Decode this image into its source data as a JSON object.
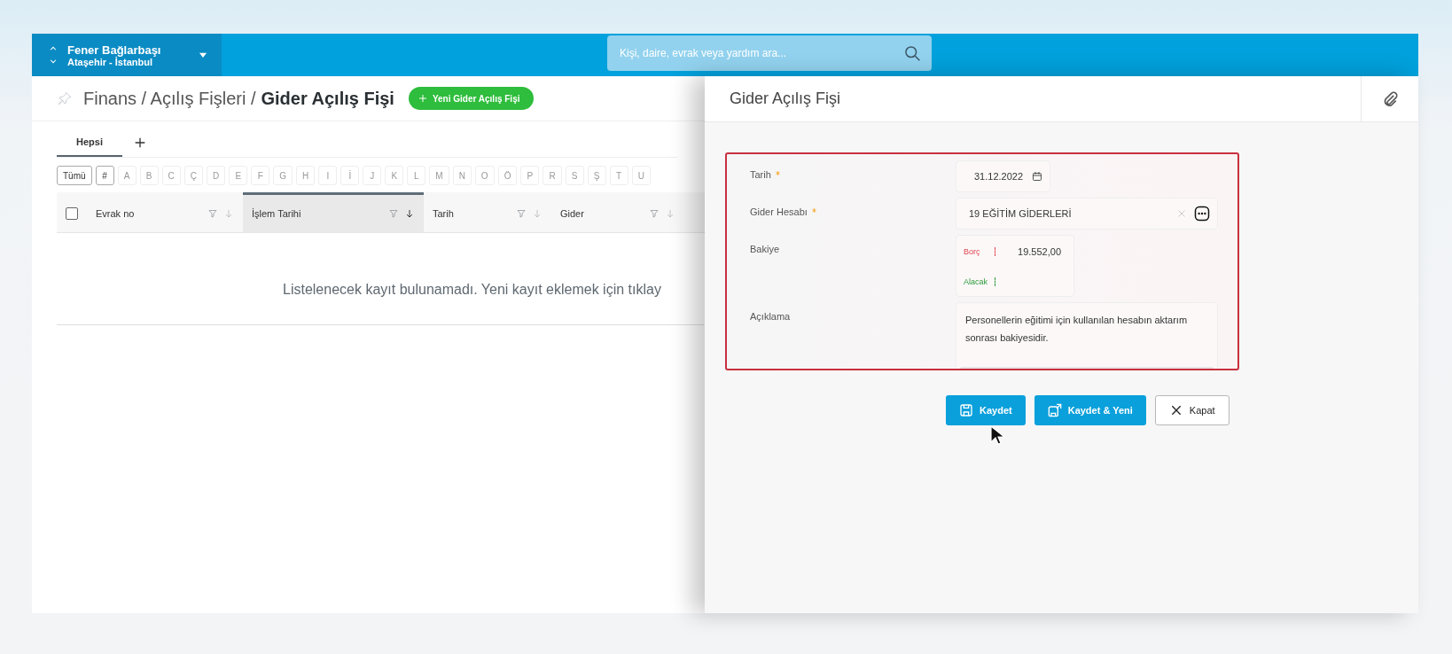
{
  "topbar": {
    "location": {
      "name": "Fener Bağlarbaşı",
      "district": "Ataşehir - İstanbul"
    },
    "search": {
      "placeholder": "Kişi, daire, evrak veya yardım ara..."
    }
  },
  "list": {
    "breadcrumb": "Finans / Açılış Fişleri /",
    "current": "Gider Açılış Fişi",
    "new_button": "Yeni Gider Açılış Fişi",
    "tabs": [
      {
        "label": "Hepsi",
        "selected": true
      }
    ],
    "filters": [
      {
        "label": "Tümü",
        "disabled": false
      },
      {
        "label": "#",
        "disabled": false
      },
      {
        "label": "A",
        "disabled": true
      },
      {
        "label": "B",
        "disabled": true
      },
      {
        "label": "C",
        "disabled": true
      },
      {
        "label": "Ç",
        "disabled": true
      },
      {
        "label": "D",
        "disabled": true
      },
      {
        "label": "E",
        "disabled": true
      },
      {
        "label": "F",
        "disabled": true
      },
      {
        "label": "G",
        "disabled": true
      },
      {
        "label": "H",
        "disabled": true
      },
      {
        "label": "I",
        "disabled": true
      },
      {
        "label": "İ",
        "disabled": true
      },
      {
        "label": "J",
        "disabled": true
      },
      {
        "label": "K",
        "disabled": true
      },
      {
        "label": "L",
        "disabled": true
      },
      {
        "label": "M",
        "disabled": true
      },
      {
        "label": "N",
        "disabled": true
      },
      {
        "label": "O",
        "disabled": true
      },
      {
        "label": "Ö",
        "disabled": true
      },
      {
        "label": "P",
        "disabled": true
      },
      {
        "label": "R",
        "disabled": true
      },
      {
        "label": "S",
        "disabled": true
      },
      {
        "label": "Ş",
        "disabled": true
      },
      {
        "label": "T",
        "disabled": true
      },
      {
        "label": "U",
        "disabled": true
      }
    ],
    "columns": [
      {
        "label": "Evrak no",
        "selected": false
      },
      {
        "label": "İşlem Tarihi",
        "selected": true
      },
      {
        "label": "Tarih",
        "selected": false
      },
      {
        "label": "Gider",
        "selected": false
      }
    ],
    "empty_message": "Listelenecek kayıt bulunamadı. Yeni kayıt eklemek için tıklay"
  },
  "form": {
    "title": "Gider Açılış Fişi",
    "fields": [
      {
        "kind": "date",
        "label": "Tarih",
        "required": true,
        "value": "31.12.2022"
      },
      {
        "kind": "lookup",
        "label": "Gider Hesabı",
        "required": true,
        "value": "19 EĞİTİM GİDERLERİ"
      },
      {
        "kind": "balance",
        "label": "Bakiye",
        "required": false,
        "debit_label": "Borç",
        "debit": "19.552,00",
        "credit_label": "Alacak"
      },
      {
        "kind": "textarea",
        "label": "Açıklama",
        "required": false,
        "value": "Personellerin eğitimi için kullanılan hesabın aktarım sonrası bakiyesidir."
      }
    ],
    "buttons": [
      {
        "kind": "primary",
        "label": "Kaydet"
      },
      {
        "kind": "primary",
        "label": "Kaydet & Yeni"
      },
      {
        "kind": "secondary",
        "label": "Kapat"
      }
    ]
  }
}
